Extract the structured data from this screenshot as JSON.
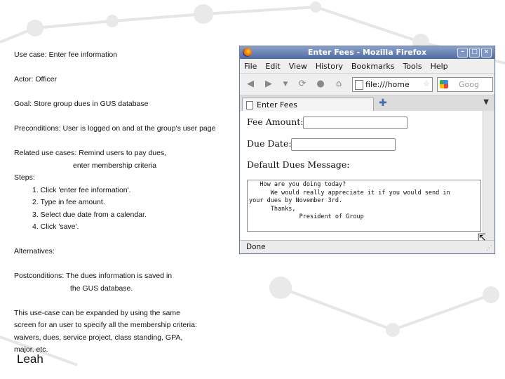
{
  "slide": {
    "use_case_label": "Use case:",
    "use_case_value": "Enter fee information",
    "actor_label": "Actor:",
    "actor_value": "Officer",
    "goal_label": "Goal:",
    "goal_value": "Store group dues in GUS database",
    "preconditions_label": "Preconditions:",
    "preconditions_value": "User is logged on and at the group's user page",
    "related_label": "Related use cases:",
    "related_value_1": "Remind users to pay dues,",
    "related_value_2": "enter membership criteria",
    "steps_label": "Steps:",
    "steps": [
      "1. Click 'enter fee information'.",
      "2. Type in fee amount.",
      "3. Select due date from a calendar.",
      "4. Click 'save'."
    ],
    "alternatives_label": "Alternatives:",
    "postconditions_label": "Postconditions:",
    "postconditions_value_1": "The dues information is saved in",
    "postconditions_value_2": "the GUS database.",
    "note_lines": [
      "This use-case can be expanded by using the same",
      "screen for an user to specify all the membership criteria:",
      "waivers, dues, service project, class standing, GPA,",
      "major, etc."
    ],
    "author": "Leah"
  },
  "browser": {
    "window_title": "Enter Fees - Mozilla Firefox",
    "menu": [
      "File",
      "Edit",
      "View",
      "History",
      "Bookmarks",
      "Tools",
      "Help"
    ],
    "url": "file:///home",
    "search_placeholder": "Goog",
    "tab_label": "Enter Fees",
    "status": "Done",
    "form": {
      "fee_amount_label": "Fee Amount:",
      "due_date_label": "Due Date:",
      "default_message_label": "Default Dues Message:",
      "default_message_text": "   How are you doing today?\n      We would really appreciate it if you would send in\nyour dues by November 3rd.\n      Thanks,\n              President of Group"
    }
  },
  "icons": {
    "back": "back-arrow-icon",
    "forward": "forward-arrow-icon",
    "reload": "reload-icon",
    "stop": "stop-icon",
    "home": "home-icon"
  }
}
